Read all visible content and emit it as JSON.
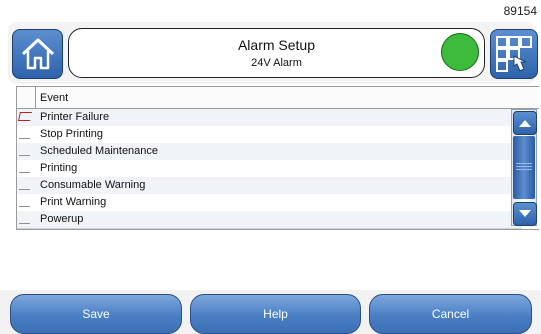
{
  "screen_id": "89154",
  "header": {
    "title": "Alarm Setup",
    "subtitle": "24V Alarm",
    "home_icon": "home-icon",
    "apps_icon": "grid-hand-icon",
    "status_color": "#3dbb3d"
  },
  "table": {
    "column_event": "Event",
    "rows": [
      {
        "label": "Printer Failure",
        "checked": true
      },
      {
        "label": "Stop Printing",
        "checked": false
      },
      {
        "label": "Scheduled Maintenance",
        "checked": false
      },
      {
        "label": "Printing",
        "checked": false
      },
      {
        "label": "Consumable Warning",
        "checked": false
      },
      {
        "label": "Print Warning",
        "checked": false
      },
      {
        "label": "Powerup",
        "checked": false
      }
    ]
  },
  "footer": {
    "save": "Save",
    "help": "Help",
    "cancel": "Cancel"
  },
  "colors": {
    "button_blue": "#4a7fc4",
    "alert_red": "#c02020"
  }
}
